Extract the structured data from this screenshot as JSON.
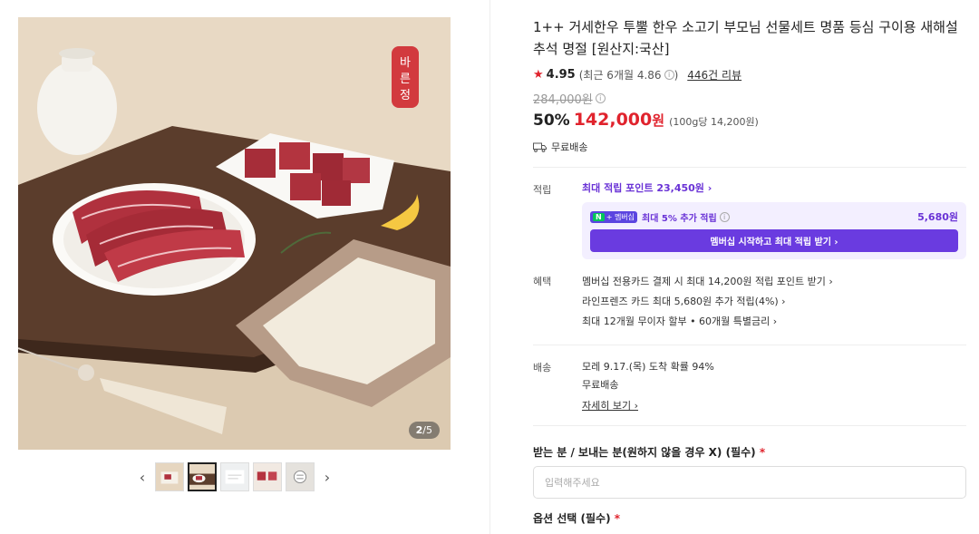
{
  "gallery": {
    "counter_current": "2",
    "counter_total": "/5",
    "brand_stamp": "바른정",
    "prev_label": "‹",
    "next_label": "›",
    "thumb_count": 5,
    "active_index": 1
  },
  "product": {
    "title": "1++ 거세한우 투뿔 한우 소고기 부모님 선물세트 명품 등심 구이용 새해설 추석 명절 [원산지:국산]",
    "rating": "4.95",
    "rating_recent": "(최근 6개월 4.86",
    "rating_recent_close": ")",
    "review_count": "446건 리뷰",
    "original_price": "284,000원",
    "discount": "50%",
    "price_number": "142,000",
    "price_unit": "원",
    "unit_price": "(100g당 14,200원)",
    "shipping_free": "무료배송"
  },
  "points": {
    "label": "적립",
    "max_points": "최대 적립 포인트 23,450원 ›",
    "npay_n": "N",
    "npay_plus": "+ 멤버십",
    "member_text": "최대 5% 추가 적립",
    "member_amount": "5,680원",
    "member_button": "멤버십 시작하고 최대 적립 받기 ›"
  },
  "benefits": {
    "label": "혜택",
    "items": [
      "멤버십 전용카드 결제 시 최대 14,200원 적립 포인트 받기 ›",
      "라인프렌즈 카드 최대 5,680원 추가 적립(4%) ›",
      "최대 12개월 무이자 할부 • 60개월 특별금리 ›"
    ]
  },
  "delivery": {
    "label": "배송",
    "arrival": "모레 9.17.(목) 도착 확률 94%",
    "fee": "무료배송",
    "detail_link": "자세히 보기 ›"
  },
  "form": {
    "recipient_label": "받는 분 / 보내는 분(원하지 않을 경우 X) (필수)",
    "required_mark": "*",
    "recipient_placeholder": "입력해주세요",
    "option_label": "옵션 선택 (필수)"
  },
  "colors": {
    "accent_red": "#e0232d",
    "accent_purple": "#6a33d6"
  }
}
